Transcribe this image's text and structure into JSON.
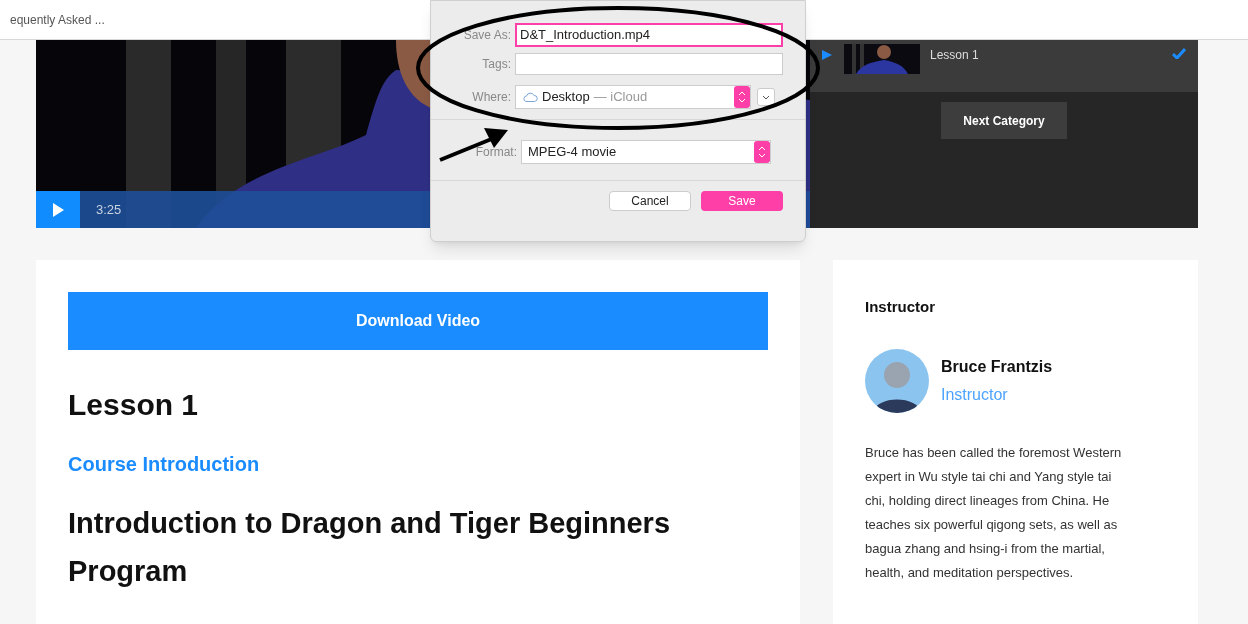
{
  "top_bar": {
    "breadcrumb": "equently Asked ..."
  },
  "video": {
    "time": "3:25"
  },
  "playlist": {
    "items": [
      {
        "title": "Lesson 1",
        "completed": true
      }
    ],
    "next_button": "Next Category"
  },
  "save_dialog": {
    "save_as": {
      "label": "Save As:",
      "value": "D&T_Introduction.mp4"
    },
    "tags": {
      "label": "Tags:"
    },
    "where": {
      "label": "Where:",
      "value": "Desktop",
      "detail": "— iCloud"
    },
    "format": {
      "label": "Format:",
      "value": "MPEG-4 movie"
    },
    "buttons": [
      {
        "label": "Cancel",
        "default": false
      },
      {
        "label": "Save",
        "default": true
      }
    ]
  },
  "lesson": {
    "download_button": "Download Video",
    "heading": "Lesson 1",
    "category": "Course Introduction",
    "title": "Introduction to Dragon and Tiger Beginners Program"
  },
  "instructor": {
    "heading": "Instructor",
    "name": "Bruce Frantzis",
    "role": "Instructor",
    "bio": "Bruce has been called the foremost Western expert in Wu style tai chi and Yang style tai chi, holding direct lineages from China. He teaches six powerful qigong sets, as well as bagua zhang and hsing-i from the martial, health, and meditation perspectives."
  }
}
